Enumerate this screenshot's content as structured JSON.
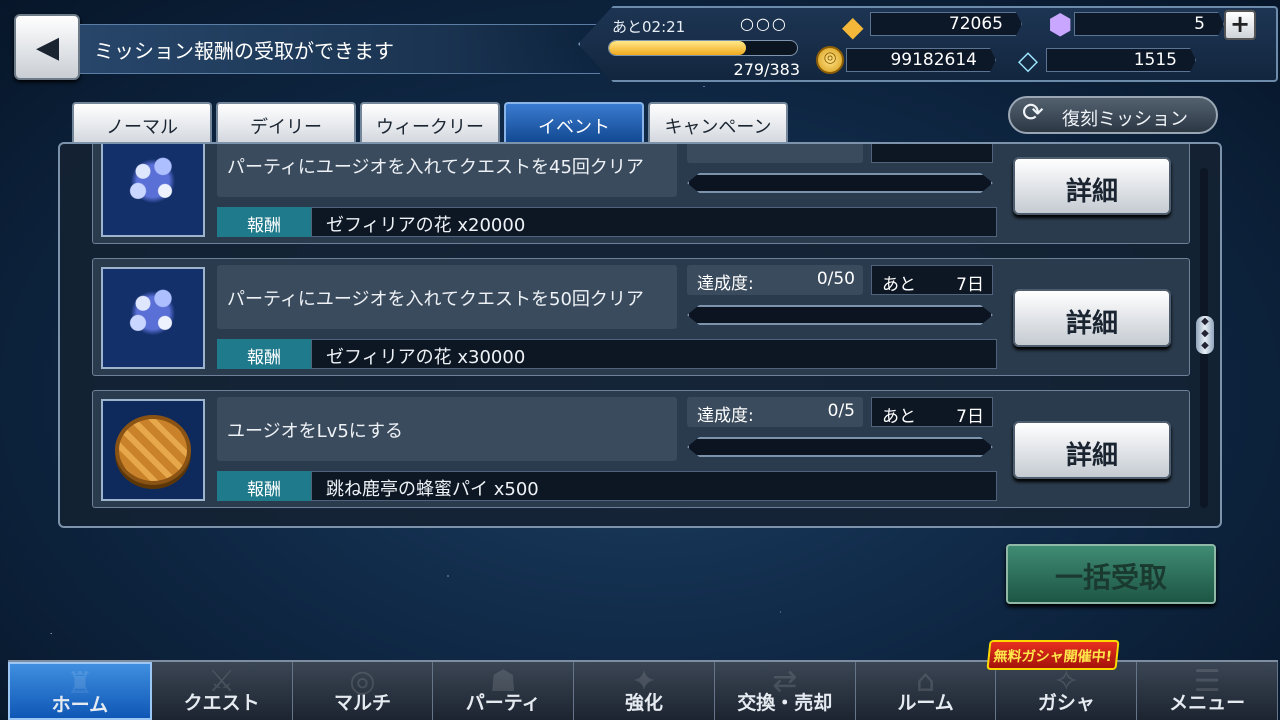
{
  "header": {
    "back_icon": "back-arrow-icon",
    "title": "ミッション報酬の受取ができます"
  },
  "status": {
    "stamina_timer": "あと02:21",
    "stamina_circles": "○○○",
    "stamina_value": "279/383",
    "stamina_fraction": 0.728,
    "gems": "72065",
    "gold": "99182614",
    "crystals": "5",
    "diamonds": "1515"
  },
  "tabs": [
    {
      "label": "ノーマル",
      "active": false
    },
    {
      "label": "デイリー",
      "active": false
    },
    {
      "label": "ウィークリー",
      "active": false
    },
    {
      "label": "イベント",
      "active": true
    },
    {
      "label": "キャンペーン",
      "active": false
    }
  ],
  "revival_button": "復刻ミッション",
  "missions": [
    {
      "description": "パーティにユージオを入れてクエストを45回クリア",
      "reward_label": "報酬",
      "reward": "ゼフィリアの花 x20000",
      "progress_label": "",
      "progress_value": "",
      "remaining_label": "",
      "remaining_value": "",
      "detail_label": "詳細",
      "icon": "flower-bouquet-icon"
    },
    {
      "description": "パーティにユージオを入れてクエストを50回クリア",
      "reward_label": "報酬",
      "reward": "ゼフィリアの花 x30000",
      "progress_label": "達成度:",
      "progress_value": "0/50",
      "remaining_label": "あと",
      "remaining_value": "7日",
      "detail_label": "詳細",
      "icon": "flower-bouquet-icon"
    },
    {
      "description": "ユージオをLv5にする",
      "reward_label": "報酬",
      "reward": "跳ね鹿亭の蜂蜜パイ x500",
      "progress_label": "達成度:",
      "progress_value": "0/5",
      "remaining_label": "あと",
      "remaining_value": "7日",
      "detail_label": "詳細",
      "icon": "honey-pie-icon"
    }
  ],
  "bulk_button": "一括受取",
  "nav": [
    {
      "label": "ホーム",
      "active": true
    },
    {
      "label": "クエスト",
      "active": false
    },
    {
      "label": "マルチ",
      "active": false
    },
    {
      "label": "パーティ",
      "active": false
    },
    {
      "label": "強化",
      "active": false
    },
    {
      "label": "交換・売却",
      "active": false
    },
    {
      "label": "ルーム",
      "active": false
    },
    {
      "label": "ガシャ",
      "active": false
    },
    {
      "label": "メニュー",
      "active": false
    }
  ],
  "gacha_badge": "無料ガシャ開催中!"
}
